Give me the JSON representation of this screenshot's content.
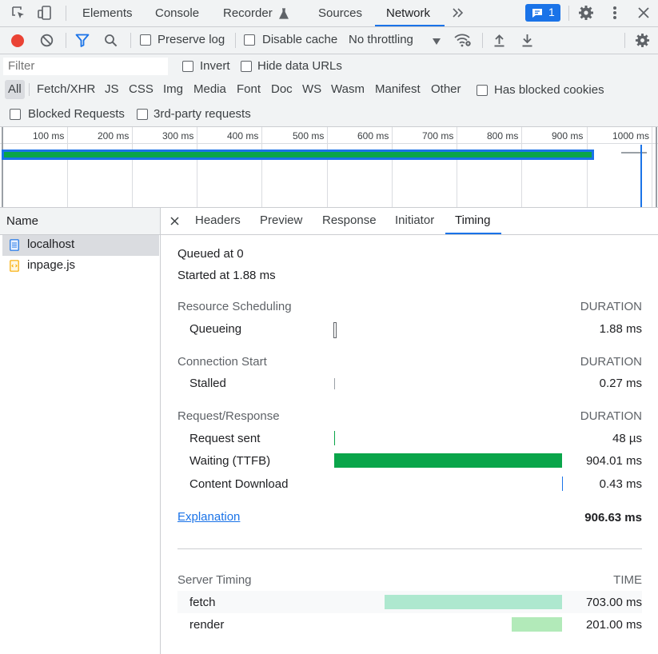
{
  "tabbar": {
    "tabs": [
      "Elements",
      "Console",
      "Recorder",
      "Sources",
      "Network"
    ],
    "active_tab": "Network",
    "issues_count": "1"
  },
  "toolbar": {
    "preserve_log": "Preserve log",
    "disable_cache": "Disable cache",
    "throttling": "No throttling"
  },
  "filter": {
    "placeholder": "Filter",
    "invert": "Invert",
    "hide_data_urls": "Hide data URLs",
    "types": [
      "All",
      "Fetch/XHR",
      "JS",
      "CSS",
      "Img",
      "Media",
      "Font",
      "Doc",
      "WS",
      "Wasm",
      "Manifest",
      "Other"
    ],
    "has_blocked_cookies": "Has blocked cookies",
    "blocked_requests": "Blocked Requests",
    "third_party": "3rd-party requests"
  },
  "overview": {
    "ticks": [
      "100 ms",
      "200 ms",
      "300 ms",
      "400 ms",
      "500 ms",
      "600 ms",
      "700 ms",
      "800 ms",
      "900 ms",
      "1000 ms"
    ]
  },
  "requests": {
    "header": "Name",
    "items": [
      {
        "name": "localhost",
        "type": "document"
      },
      {
        "name": "inpage.js",
        "type": "script"
      }
    ]
  },
  "detail": {
    "tabs": [
      "Headers",
      "Preview",
      "Response",
      "Initiator",
      "Timing"
    ],
    "active_tab": "Timing",
    "queued": "Queued at 0",
    "started": "Started at 1.88 ms",
    "duration_label": "DURATION",
    "resource_scheduling": {
      "title": "Resource Scheduling",
      "rows": [
        {
          "label": "Queueing",
          "value": "1.88 ms"
        }
      ]
    },
    "connection_start": {
      "title": "Connection Start",
      "rows": [
        {
          "label": "Stalled",
          "value": "0.27 ms"
        }
      ]
    },
    "request_response": {
      "title": "Request/Response",
      "rows": [
        {
          "label": "Request sent",
          "value": "48 µs"
        },
        {
          "label": "Waiting (TTFB)",
          "value": "904.01 ms"
        },
        {
          "label": "Content Download",
          "value": "0.43 ms"
        }
      ]
    },
    "explanation": "Explanation",
    "total": "906.63 ms",
    "server_timing": {
      "title": "Server Timing",
      "time_label": "TIME",
      "rows": [
        {
          "label": "fetch",
          "value": "703.00 ms"
        },
        {
          "label": "render",
          "value": "201.00 ms"
        }
      ]
    }
  },
  "colors": {
    "accent": "#1a73e8",
    "waiting_bar": "#0aa54a",
    "fetch_bar": "#aee8cf",
    "render_bar": "#b2eab9",
    "record_red": "#ea4335"
  }
}
